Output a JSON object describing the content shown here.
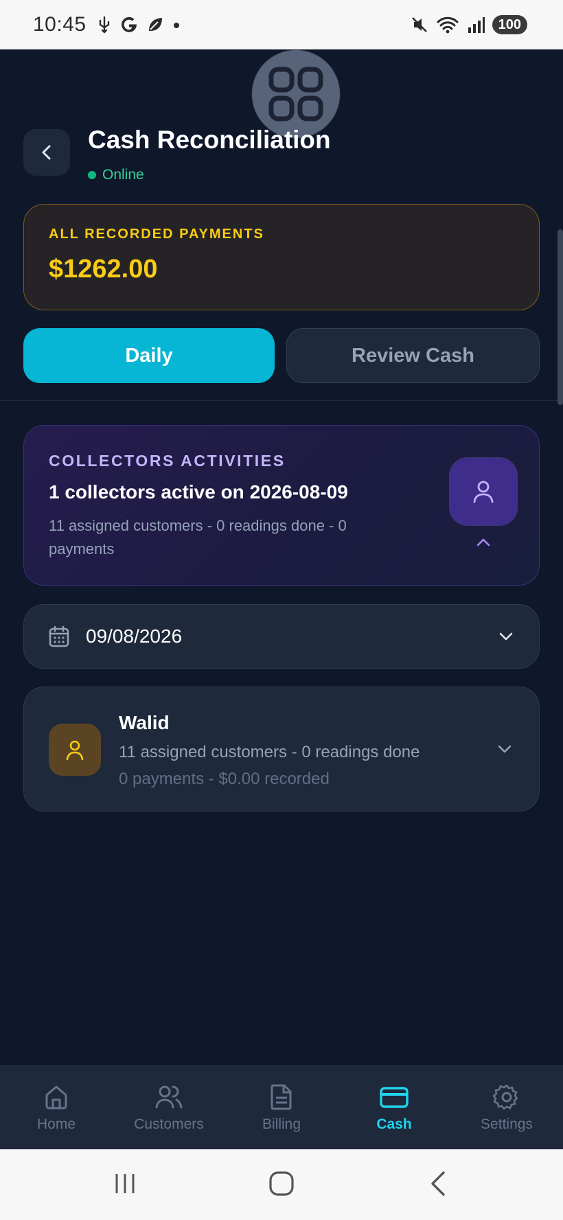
{
  "status_bar": {
    "time": "10:45",
    "battery": "100",
    "icons_left": [
      "usb-icon",
      "google-icon",
      "leaf-icon",
      "dot-icon"
    ],
    "icons_right": [
      "mute-icon",
      "wifi-icon",
      "signal-icon",
      "battery-icon"
    ]
  },
  "header": {
    "title": "Cash Reconciliation",
    "status": "Online"
  },
  "total": {
    "label": "ALL RECORDED PAYMENTS",
    "value": "$1262.00"
  },
  "tabs": {
    "daily": "Daily",
    "review": "Review Cash",
    "active": "daily"
  },
  "collectors": {
    "label": "COLLECTORS ACTIVITIES",
    "title": "1 collectors active on 2026-08-09",
    "description": "11 assigned customers - 0 readings done - 0 payments"
  },
  "date_picker": {
    "value": "09/08/2026"
  },
  "collector_list": [
    {
      "name": "Walid",
      "line1": "11 assigned customers - 0 readings done",
      "line2": "0 payments - $0.00 recorded"
    }
  ],
  "bottom_nav": {
    "items": [
      {
        "label": "Home",
        "icon": "home-icon"
      },
      {
        "label": "Customers",
        "icon": "users-icon"
      },
      {
        "label": "Billing",
        "icon": "document-icon"
      },
      {
        "label": "Cash",
        "icon": "card-icon"
      },
      {
        "label": "Settings",
        "icon": "gear-icon"
      }
    ],
    "active": "Cash"
  },
  "colors": {
    "background": "#0f172a",
    "accent": "#06b6d4",
    "gold": "#facc15",
    "purple": "#c4b5fd",
    "online": "#10b981"
  }
}
